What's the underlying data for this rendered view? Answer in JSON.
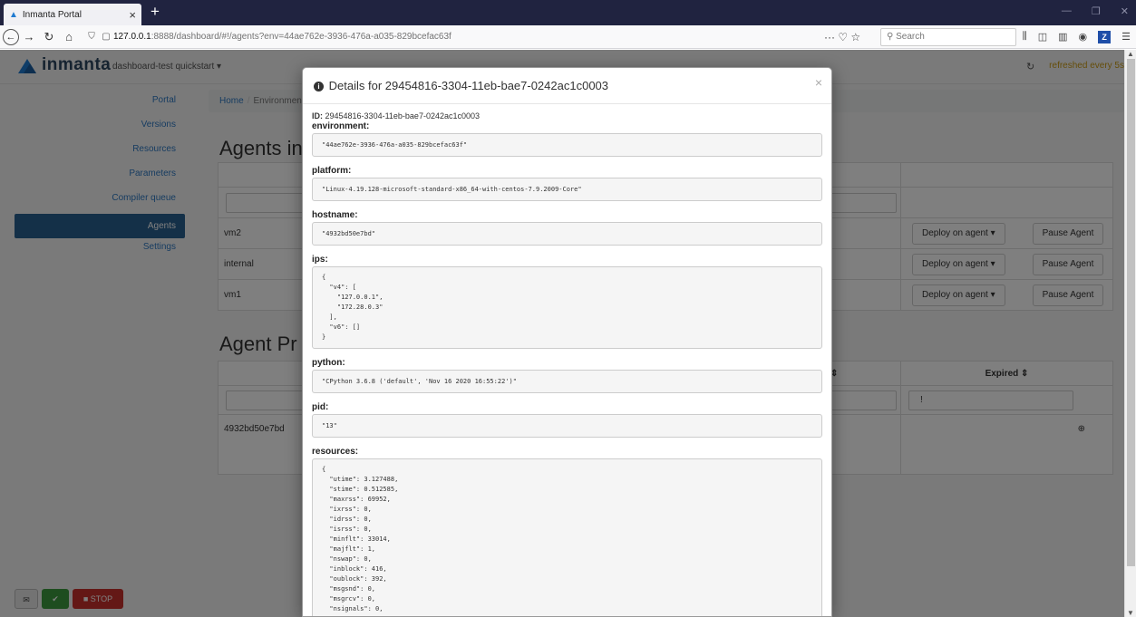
{
  "browser": {
    "tab_title": "Inmanta Portal",
    "url_host": "127.0.0.1",
    "url_rest": ":8888/dashboard/#!/agents?env=44ae762e-3936-476a-a035-829bcefac63f",
    "search_placeholder": "Search",
    "page_actions": "··· ♡ ☆"
  },
  "app": {
    "brand": "inmanta",
    "env_selector": "dashboard-test quickstart ▾",
    "refresh_text": "refreshed every 5s",
    "sidebar": [
      "Portal",
      "Versions",
      "Resources",
      "Parameters",
      "Compiler queue",
      "Agents",
      "Settings"
    ],
    "active_item": "Agents",
    "breadcrumb": {
      "home": "Home",
      "env": "Environment"
    },
    "agents_heading": "Agents in",
    "agents_table": {
      "headers": [
        "Nam",
        "er ⇕",
        ""
      ],
      "rows": [
        {
          "name": "vm2",
          "deploy": "Deploy on agent ▾",
          "pause": "Pause Agent"
        },
        {
          "name": "internal",
          "deploy": "Deploy on agent ▾",
          "pause": "Pause Agent"
        },
        {
          "name": "vm1",
          "deploy": "Deploy on agent ▾",
          "pause": "Pause Agent"
        }
      ]
    },
    "procs_heading": "Agent Pr",
    "procs_table": {
      "headers": [
        "Host",
        "⇕",
        "Expired ⇕"
      ],
      "filter_value": "!",
      "rows": [
        {
          "host": "4932bd50e7bd"
        }
      ]
    },
    "bottom_buttons": {
      "message": "✉",
      "ok": "✔",
      "stop": "■   STOP"
    }
  },
  "modal": {
    "title": "Details for 29454816-3304-11eb-bae7-0242ac1c0003",
    "id_label": "ID:",
    "id_value": "29454816-3304-11eb-bae7-0242ac1c0003",
    "fields": [
      {
        "label": "environment:",
        "value": "\"44ae762e-3936-476a-a035-829bcefac63f\""
      },
      {
        "label": "platform:",
        "value": "\"Linux-4.19.128-microsoft-standard-x86_64-with-centos-7.9.2009-Core\""
      },
      {
        "label": "hostname:",
        "value": "\"4932bd50e7bd\""
      },
      {
        "label": "ips:",
        "value": "{\n  \"v4\": [\n    \"127.0.0.1\",\n    \"172.28.0.3\"\n  ],\n  \"v6\": []\n}"
      },
      {
        "label": "python:",
        "value": "\"CPython 3.6.8 ('default', 'Nov 16 2020 16:55:22')\""
      },
      {
        "label": "pid:",
        "value": "\"13\""
      },
      {
        "label": "resources:",
        "value": "{\n  \"utime\": 3.127488,\n  \"stime\": 0.512585,\n  \"maxrss\": 69952,\n  \"ixrss\": 0,\n  \"idrss\": 0,\n  \"isrss\": 0,\n  \"minflt\": 33014,\n  \"majflt\": 1,\n  \"nswap\": 0,\n  \"inblock\": 416,\n  \"oublock\": 392,\n  \"msgsnd\": 0,\n  \"msgrcv\": 0,\n  \"nsignals\": 0,"
      }
    ]
  }
}
